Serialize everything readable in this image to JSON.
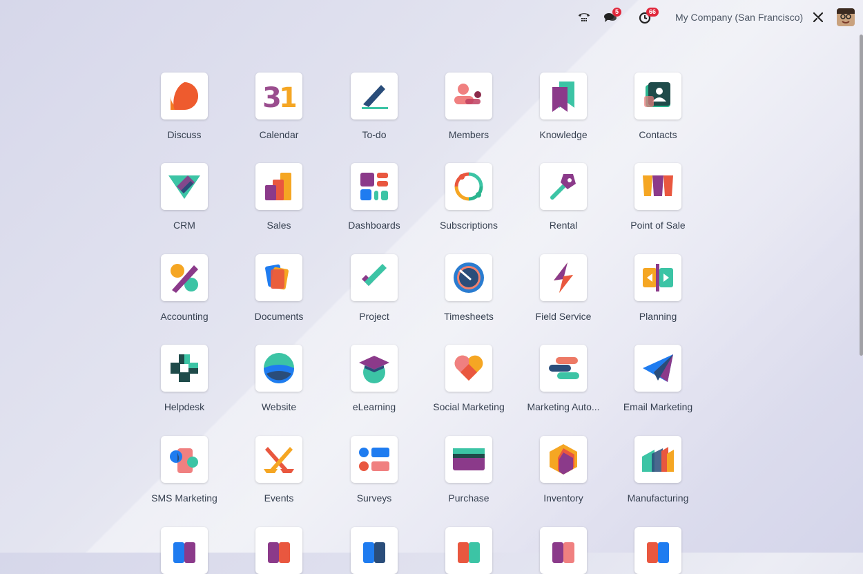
{
  "topbar": {
    "chat_badge": "5",
    "activity_badge": "66",
    "company": "My Company (San Francisco)"
  },
  "apps": [
    {
      "label": "Discuss",
      "icon": "discuss-icon"
    },
    {
      "label": "Calendar",
      "icon": "calendar-icon"
    },
    {
      "label": "To-do",
      "icon": "todo-icon"
    },
    {
      "label": "Members",
      "icon": "members-icon"
    },
    {
      "label": "Knowledge",
      "icon": "knowledge-icon"
    },
    {
      "label": "Contacts",
      "icon": "contacts-icon"
    },
    {
      "label": "CRM",
      "icon": "crm-icon"
    },
    {
      "label": "Sales",
      "icon": "sales-icon"
    },
    {
      "label": "Dashboards",
      "icon": "dashboards-icon"
    },
    {
      "label": "Subscriptions",
      "icon": "subscriptions-icon"
    },
    {
      "label": "Rental",
      "icon": "rental-icon"
    },
    {
      "label": "Point of Sale",
      "icon": "point-of-sale-icon"
    },
    {
      "label": "Accounting",
      "icon": "accounting-icon"
    },
    {
      "label": "Documents",
      "icon": "documents-icon"
    },
    {
      "label": "Project",
      "icon": "project-icon"
    },
    {
      "label": "Timesheets",
      "icon": "timesheets-icon"
    },
    {
      "label": "Field Service",
      "icon": "field-service-icon"
    },
    {
      "label": "Planning",
      "icon": "planning-icon"
    },
    {
      "label": "Helpdesk",
      "icon": "helpdesk-icon"
    },
    {
      "label": "Website",
      "icon": "website-icon"
    },
    {
      "label": "eLearning",
      "icon": "elearning-icon"
    },
    {
      "label": "Social Marketing",
      "icon": "social-marketing-icon"
    },
    {
      "label": "Marketing Auto...",
      "icon": "marketing-automation-icon"
    },
    {
      "label": "Email Marketing",
      "icon": "email-marketing-icon"
    },
    {
      "label": "SMS Marketing",
      "icon": "sms-marketing-icon"
    },
    {
      "label": "Events",
      "icon": "events-icon"
    },
    {
      "label": "Surveys",
      "icon": "surveys-icon"
    },
    {
      "label": "Purchase",
      "icon": "purchase-icon"
    },
    {
      "label": "Inventory",
      "icon": "inventory-icon"
    },
    {
      "label": "Manufacturing",
      "icon": "manufacturing-icon"
    }
  ]
}
